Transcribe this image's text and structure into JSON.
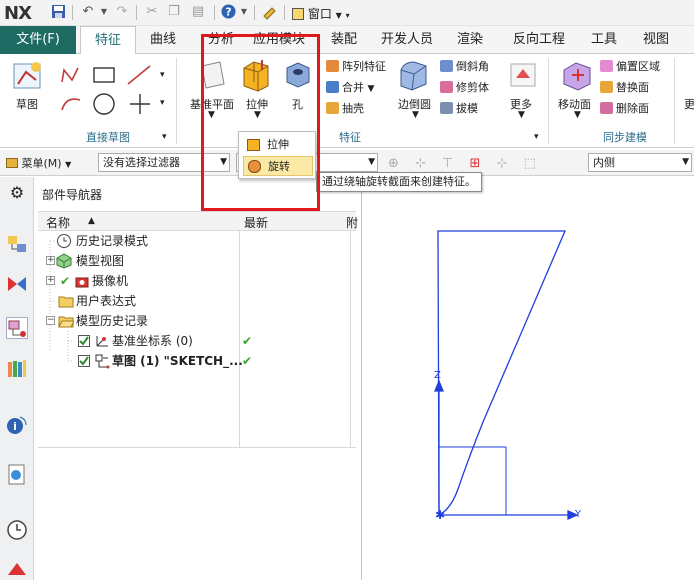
{
  "app": {
    "logo": "NX",
    "window_menu": "窗口"
  },
  "tabs": [
    "文件(F)",
    "特征",
    "曲线",
    "分析",
    "应用模块",
    "装配",
    "开发人员",
    "渲染",
    "反向工程",
    "工具",
    "视图"
  ],
  "ribbon": {
    "direct_sketch": {
      "sketch": "草图",
      "group": "直接草图"
    },
    "feature": {
      "datum_plane": "基准平面",
      "extrude": "拉伸",
      "hole": "孔",
      "pattern": "阵列特征",
      "unite": "合并",
      "shell": "抽壳",
      "edge_blend": "边倒圆",
      "chamfer": "倒斜角",
      "trim_body": "修剪体",
      "draft": "拔模",
      "more": "更多",
      "group": "特征"
    },
    "sync": {
      "move_face": "移动面",
      "offset_region": "偏置区域",
      "replace_face": "替换面",
      "delete_face": "删除面",
      "more": "更",
      "group": "同步建模"
    }
  },
  "cmdbar": {
    "menu": "菜单(M)",
    "filter": "没有选择过滤器",
    "inside": "内侧"
  },
  "dropdown": {
    "extrude": "拉伸",
    "revolve": "旋转"
  },
  "tooltip": "通过绕轴旋转截面来创建特征。",
  "navigator": {
    "title": "部件导航器",
    "col_name": "名称",
    "col_latest": "最新",
    "col_third": "附",
    "items": [
      {
        "label": "历史记录模式"
      },
      {
        "label": "模型视图"
      },
      {
        "label": "摄像机"
      },
      {
        "label": "用户表达式"
      },
      {
        "label": "模型历史记录"
      },
      {
        "label": "基准坐标系 (0)",
        "latest": "✔"
      },
      {
        "label": "草图 (1) \"SKETCH_...",
        "latest": "✔"
      }
    ]
  },
  "graphics": {
    "axis_z": "Z",
    "axis_y": "Y",
    "line_color": "#1f3fdc"
  },
  "colors": {
    "file_tab": "#1e6b63",
    "active_tab_text": "#1f6e74",
    "highlight_box": "#e0191d"
  }
}
